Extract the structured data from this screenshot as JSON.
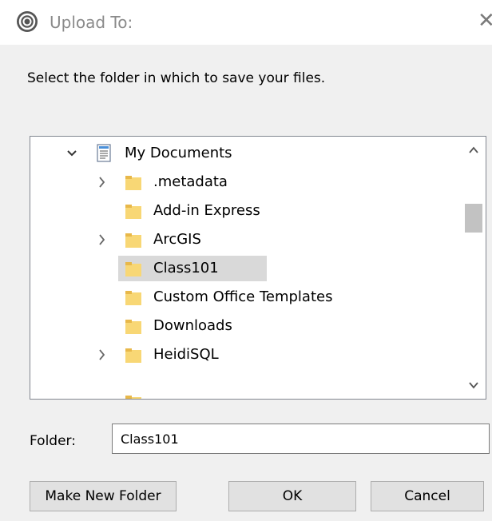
{
  "window": {
    "title": "Upload To:",
    "close_glyph": "✕",
    "app_icon": "app-logo-icon"
  },
  "prompt": "Select the folder in which to save your files.",
  "tree": {
    "items": [
      {
        "label": "My Documents",
        "icon": "documents-icon",
        "expander": "expanded"
      },
      {
        "label": ".metadata",
        "icon": "folder-icon",
        "expander": "collapsed"
      },
      {
        "label": "Add-in Express",
        "icon": "folder-icon",
        "expander": "none"
      },
      {
        "label": "ArcGIS",
        "icon": "folder-icon",
        "expander": "collapsed"
      },
      {
        "label": "Class101",
        "icon": "folder-icon",
        "expander": "none",
        "selected": true
      },
      {
        "label": "Custom Office Templates",
        "icon": "folder-icon",
        "expander": "none"
      },
      {
        "label": "Downloads",
        "icon": "folder-icon",
        "expander": "none"
      },
      {
        "label": "HeidiSQL",
        "icon": "folder-icon",
        "expander": "collapsed"
      }
    ],
    "scroll_up": "⌃",
    "scroll_down": "⌄"
  },
  "folder": {
    "label": "Folder:",
    "value": "Class101"
  },
  "buttons": {
    "make_new_folder": "Make New Folder",
    "ok": "OK",
    "cancel": "Cancel"
  },
  "colors": {
    "folder_fill": "#f8d775",
    "folder_tab": "#e8b84a",
    "selection": "#d9d9d9",
    "dialog_bg": "#f0f0f0"
  }
}
